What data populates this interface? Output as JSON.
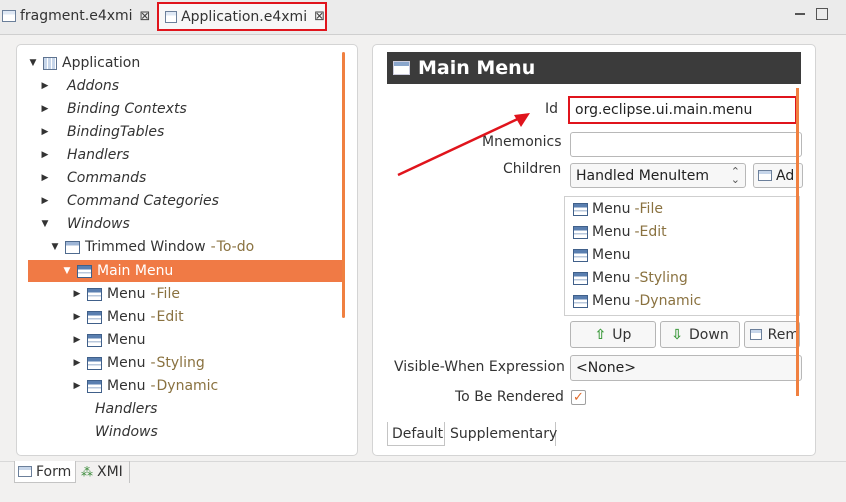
{
  "tabs": [
    {
      "label": "fragment.e4xmi",
      "active": false
    },
    {
      "label": "Application.e4xmi",
      "active": true
    }
  ],
  "tab_close_glyph": "⊠",
  "tree": {
    "root": "Application",
    "items": [
      {
        "label": "Addons"
      },
      {
        "label": "Binding Contexts"
      },
      {
        "label": "BindingTables"
      },
      {
        "label": "Handlers"
      },
      {
        "label": "Commands"
      },
      {
        "label": "Command Categories"
      },
      {
        "label": "Windows"
      }
    ],
    "trimmed_window": {
      "label": "Trimmed Window",
      "sub": "To-do"
    },
    "selected": "Main Menu",
    "menus": [
      {
        "label": "Menu",
        "sub": "File"
      },
      {
        "label": "Menu",
        "sub": "Edit"
      },
      {
        "label": "Menu",
        "sub": ""
      },
      {
        "label": "Menu",
        "sub": "Styling"
      },
      {
        "label": "Menu",
        "sub": "Dynamic"
      }
    ],
    "trailing": [
      "Handlers",
      "Windows"
    ],
    "dash": "-"
  },
  "details": {
    "title": "Main Menu",
    "id_label": "Id",
    "id_value": "org.eclipse.ui.main.menu",
    "mnemonics_label": "Mnemonics",
    "mnemonics_value": "",
    "children_label": "Children",
    "children_type": "Handled MenuItem",
    "add_label": "Ad",
    "children": [
      {
        "label": "Menu",
        "sub": "File"
      },
      {
        "label": "Menu",
        "sub": "Edit"
      },
      {
        "label": "Menu",
        "sub": ""
      },
      {
        "label": "Menu",
        "sub": "Styling"
      },
      {
        "label": "Menu",
        "sub": "Dynamic"
      }
    ],
    "up_label": "Up",
    "down_label": "Down",
    "remove_label": "Rem",
    "visible_when_label": "Visible-When Expression",
    "visible_when_value": "<None>",
    "to_be_rendered_label": "To Be Rendered",
    "to_be_rendered_checked": true,
    "subtabs": [
      "Default",
      "Supplementary"
    ]
  },
  "footer_tabs": [
    "Form",
    "XMI"
  ],
  "colors": {
    "accent": "#f07a45",
    "annotation": "#e0141c",
    "header": "#3b3b3b"
  }
}
